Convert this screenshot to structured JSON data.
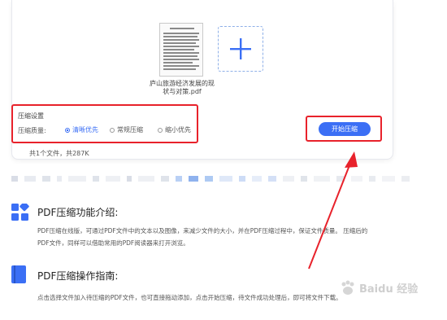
{
  "file": {
    "name_line1": "庐山旅游经济发展的现",
    "name_line2": "状与对策.pdf"
  },
  "compress": {
    "settings_title": "压缩设置",
    "quality_label": "压缩质量:",
    "options": [
      "清晰优先",
      "常规压缩",
      "缩小优先"
    ],
    "selected_option": "清晰优先",
    "start_button": "开始压缩",
    "file_count": "共1个文件，共287K"
  },
  "intro": {
    "title": "PDF压缩功能介绍:",
    "line1": "PDF压缩在线版，可通过PDF文件中的文本以及图像，来减少文件的大小，并在PDF压缩过程中，保证文件质量。 压缩后的",
    "line2": "PDF文件，同样可以借助常用的PDF阅读器来打开浏览。"
  },
  "guide": {
    "title": "PDF压缩操作指南:",
    "line1": "点击选择文件加入待压缩的PDF文件，也可直接拖动添加，点击开始压缩，待文件成功处理后，即可将文件下载。"
  },
  "watermark": {
    "text": "Baidu 经验"
  },
  "colors": {
    "accent": "#3b6ff5",
    "highlight": "#e8222b"
  }
}
